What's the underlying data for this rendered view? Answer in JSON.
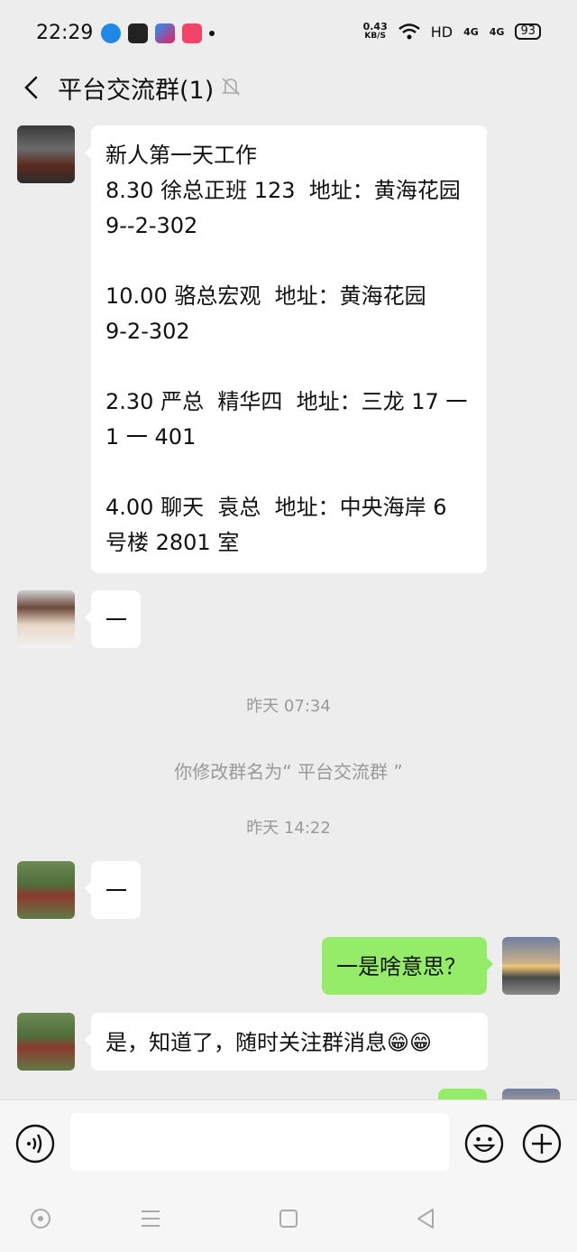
{
  "status": {
    "time": "22:29",
    "speed_value": "0.43",
    "speed_unit": "KB/S",
    "hd": "HD",
    "net1": "4G",
    "net2": "4G",
    "battery": "93"
  },
  "header": {
    "title": "平台交流群(1)"
  },
  "messages": {
    "m1": [
      "新人第一天工作",
      "8.30 徐总正班 123  地址：黄海花园",
      "9--2-302",
      " ",
      "10.00 骆总宏观  地址：黄海花园",
      "9-2-302",
      " ",
      "2.30 严总  精华四  地址：三龙 17 一",
      "1 一 401",
      " ",
      "4.00 聊天  袁总  地址：中央海岸 6",
      "号楼 2801 室"
    ],
    "m2": "一",
    "sys1": "昨天 07:34",
    "sys2": "你修改群名为“ 平台交流群 ”",
    "sys3": "昨天 14:22",
    "m3": "一",
    "m4": "一是啥意思？",
    "m5": "是，知道了，随时关注群消息😁😁"
  },
  "input": {
    "placeholder": ""
  },
  "colors": {
    "background": "#ededed",
    "bubble_self": "#95ec69",
    "bubble_other": "#ffffff"
  }
}
